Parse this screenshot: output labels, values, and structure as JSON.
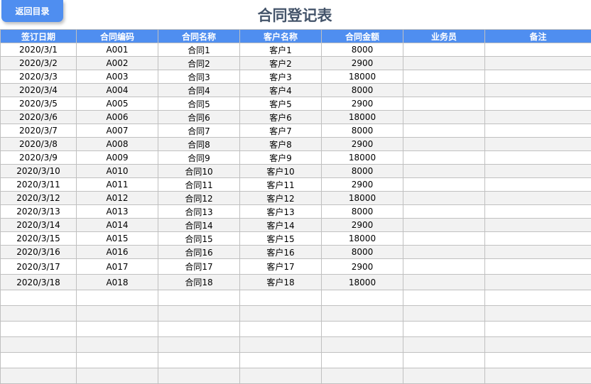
{
  "back_button": "返回目录",
  "title": "合同登记表",
  "columns": [
    "签订日期",
    "合同编码",
    "合同名称",
    "客户名称",
    "合同金额",
    "业务员",
    "备注"
  ],
  "rows": [
    [
      "2020/3/1",
      "A001",
      "合同1",
      "客户1",
      "8000",
      "",
      ""
    ],
    [
      "2020/3/2",
      "A002",
      "合同2",
      "客户2",
      "2900",
      "",
      ""
    ],
    [
      "2020/3/3",
      "A003",
      "合同3",
      "客户3",
      "18000",
      "",
      ""
    ],
    [
      "2020/3/4",
      "A004",
      "合同4",
      "客户4",
      "8000",
      "",
      ""
    ],
    [
      "2020/3/5",
      "A005",
      "合同5",
      "客户5",
      "2900",
      "",
      ""
    ],
    [
      "2020/3/6",
      "A006",
      "合同6",
      "客户6",
      "18000",
      "",
      ""
    ],
    [
      "2020/3/7",
      "A007",
      "合同7",
      "客户7",
      "8000",
      "",
      ""
    ],
    [
      "2020/3/8",
      "A008",
      "合同8",
      "客户8",
      "2900",
      "",
      ""
    ],
    [
      "2020/3/9",
      "A009",
      "合同9",
      "客户9",
      "18000",
      "",
      ""
    ],
    [
      "2020/3/10",
      "A010",
      "合同10",
      "客户10",
      "8000",
      "",
      ""
    ],
    [
      "2020/3/11",
      "A011",
      "合同11",
      "客户11",
      "2900",
      "",
      ""
    ],
    [
      "2020/3/12",
      "A012",
      "合同12",
      "客户12",
      "18000",
      "",
      ""
    ],
    [
      "2020/3/13",
      "A013",
      "合同13",
      "客户13",
      "8000",
      "",
      ""
    ],
    [
      "2020/3/14",
      "A014",
      "合同14",
      "客户14",
      "2900",
      "",
      ""
    ],
    [
      "2020/3/15",
      "A015",
      "合同15",
      "客户15",
      "18000",
      "",
      ""
    ],
    [
      "2020/3/16",
      "A016",
      "合同16",
      "客户16",
      "8000",
      "",
      ""
    ],
    [
      "2020/3/17",
      "A017",
      "合同17",
      "客户17",
      "2900",
      "",
      ""
    ],
    [
      "2020/3/18",
      "A018",
      "合同18",
      "客户18",
      "18000",
      "",
      ""
    ]
  ],
  "empty_rows": 6
}
